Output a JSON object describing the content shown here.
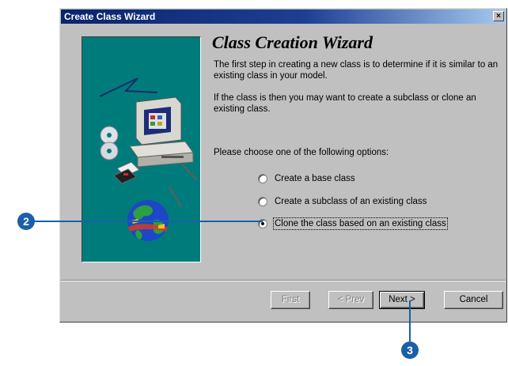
{
  "window": {
    "title": "Create Class Wizard",
    "close_glyph": "×"
  },
  "heading": "Class Creation Wizard",
  "intro": [
    "The first step in creating a new class is to determine if it is similar to an existing class in your model.",
    "If the class is then you may want to create a subclass or clone an existing class."
  ],
  "prompt": "Please choose one of the following options:",
  "options": [
    {
      "label": "Create a base class",
      "selected": false
    },
    {
      "label": "Create a subclass of an existing class",
      "selected": false
    },
    {
      "label": "Clone the class based on an existing class",
      "selected": true
    }
  ],
  "buttons": {
    "first": "First",
    "prev": "< Prev",
    "next": "Next >",
    "cancel": "Cancel"
  },
  "callouts": {
    "step_a": "2",
    "step_b": "3"
  },
  "colors": {
    "title_start": "#0a246a",
    "title_end": "#a6caf0",
    "panel": "#c0c0c0",
    "art_bg": "#007b7b",
    "callout": "#1a5fa8"
  },
  "icons": [
    "close-icon",
    "computer-icon",
    "cd-disc-icon",
    "floppy-disk-icon",
    "globe-icon"
  ]
}
